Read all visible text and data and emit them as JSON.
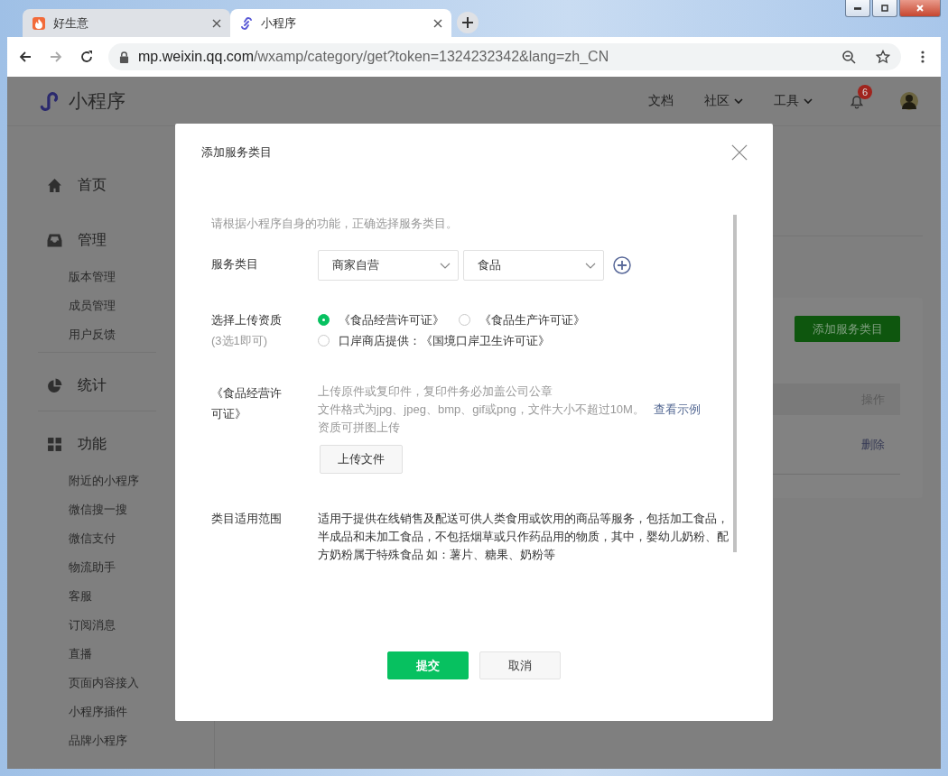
{
  "browser": {
    "tabs": [
      {
        "title": "好生意",
        "selected": false
      },
      {
        "title": "小程序",
        "selected": true
      }
    ],
    "url": {
      "host": "mp.weixin.qq.com",
      "path": "/wxamp/category/get?token=1324232342&lang=zh_CN"
    }
  },
  "header": {
    "logo": "小程序",
    "nav": [
      {
        "label": "文档",
        "dropdown": false
      },
      {
        "label": "社区",
        "dropdown": true
      },
      {
        "label": "工具",
        "dropdown": true
      }
    ],
    "notification_count": "6"
  },
  "sidebar": {
    "sections": [
      {
        "label": "首页"
      },
      {
        "label": "管理",
        "children": [
          "版本管理",
          "成员管理",
          "用户反馈"
        ]
      },
      {
        "label": "统计"
      },
      {
        "label": "功能",
        "children": [
          "附近的小程序",
          "微信搜一搜",
          "微信支付",
          "物流助手",
          "客服",
          "订阅消息",
          "直播",
          "页面内容接入",
          "小程序插件",
          "品牌小程序"
        ]
      }
    ]
  },
  "main": {
    "action_button": "添加服务类目",
    "table": {
      "columns": [
        "操作"
      ],
      "rows": [
        [
          "删除"
        ]
      ]
    }
  },
  "dialog": {
    "title": "添加服务类目",
    "intro": "请根据小程序自身的功能，正确选择服务类目。",
    "fields": [
      {
        "kind": "selects",
        "label": "服务类目",
        "selects": [
          "商家自营",
          "食品"
        ]
      },
      {
        "kind": "radios",
        "label": "选择上传资质",
        "sublabel": "(3选1即可)",
        "options": [
          {
            "label": "《食品经营许可证》",
            "selected": true
          },
          {
            "label": "《食品生产许可证》",
            "selected": false
          },
          {
            "label": "口岸商店提供：《国境口岸卫生许可证》",
            "selected": false
          }
        ]
      },
      {
        "kind": "upload",
        "label": "《食品经营许可证》",
        "hints": [
          "上传原件或复印件，复印件务必加盖公司公章",
          "文件格式为jpg、jpeg、bmp、gif或png，文件大小不超过10M。",
          "资质可拼图上传"
        ],
        "link": "查看示例",
        "button": "上传文件"
      },
      {
        "kind": "text",
        "label": "类目适用范围",
        "text": "适用于提供在线销售及配送可供人类食用或饮用的商品等服务，包括加工食品，半成品和未加工食品，不包括烟草或只作药品用的物质，其中，婴幼儿奶粉、配方奶粉属于特殊食品 如：薯片、糖果、奶粉等"
      }
    ],
    "buttons": [
      {
        "label": "提交",
        "primary": true
      },
      {
        "label": "取消",
        "primary": false
      }
    ]
  }
}
